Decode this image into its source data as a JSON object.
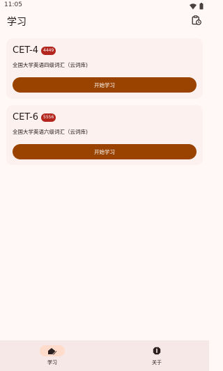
{
  "status_bar": {
    "time": "11:05",
    "icons": [
      "wifi-icon",
      "battery-icon"
    ]
  },
  "app_bar": {
    "title": "学习",
    "action_icon": "history-icon"
  },
  "books": [
    {
      "title": "CET-4",
      "count": "4449",
      "subtitle": "全国大学英语四级词汇（云词库)",
      "button_label": "开始学习"
    },
    {
      "title": "CET-6",
      "count": "5556",
      "subtitle": "全国大学英语六级词汇（云词库)",
      "button_label": "开始学习"
    }
  ],
  "bottom_nav": {
    "items": [
      {
        "label": "学习",
        "icon": "learn-icon",
        "selected": true
      },
      {
        "label": "关于",
        "icon": "about-icon",
        "selected": false
      }
    ]
  },
  "colors": {
    "background": "#FFF8F7",
    "card": "#FDF1EF",
    "primary_button": "#9A4300",
    "badge": "#B3261E",
    "nav_background": "#F6E8E6",
    "nav_indicator": "#FFDBCC"
  }
}
